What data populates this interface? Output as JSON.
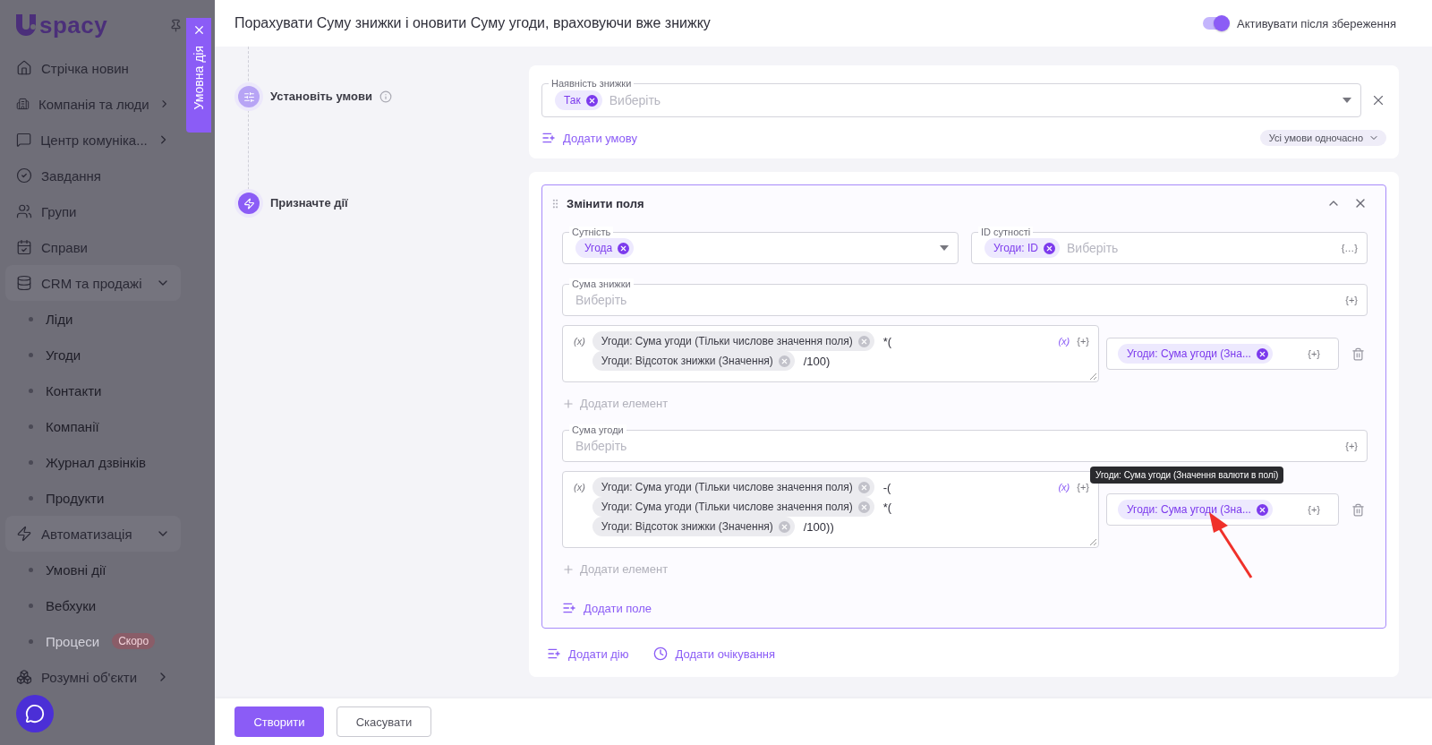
{
  "sidebar": {
    "logo_text": "spacy",
    "items": [
      {
        "label": "Стрічка новин"
      },
      {
        "label": "Компанія та люди",
        "expanded": false
      },
      {
        "label": "Центр комуніка...",
        "expanded": false
      },
      {
        "label": "Завдання"
      },
      {
        "label": "Групи"
      },
      {
        "label": "Справи"
      },
      {
        "label": "CRM та продажі",
        "expanded": true,
        "children": [
          {
            "label": "Ліди",
            "disabled": false
          },
          {
            "label": "Угоди",
            "disabled": false
          },
          {
            "label": "Контакти",
            "disabled": false
          },
          {
            "label": "Компанії",
            "disabled": false
          },
          {
            "label": "Журнал дзвінків",
            "disabled": false
          },
          {
            "label": "Продукти",
            "disabled": false
          }
        ]
      },
      {
        "label": "Автоматизація",
        "expanded": true,
        "children": [
          {
            "label": "Умовні дії",
            "disabled": false
          },
          {
            "label": "Вебхуки",
            "disabled": false
          },
          {
            "label": "Процеси",
            "disabled": true,
            "badge": "Скоро"
          }
        ]
      },
      {
        "label": "Розумні об'єкти",
        "expanded": false
      }
    ]
  },
  "side_tab": {
    "label": "Умовна дія"
  },
  "header": {
    "title": "Порахувати Суму знижки і оновити Суму угоди, враховуючи вже знижку",
    "activate_toggle": {
      "label": "Активувати після збереження",
      "on": true
    }
  },
  "steps": [
    {
      "label": "Установіть умови",
      "kind": "conditions"
    },
    {
      "label": "Призначте дії",
      "kind": "actions"
    }
  ],
  "conditions": {
    "field_label": "Наявність знижки",
    "chips": [
      {
        "label": "Так"
      }
    ],
    "placeholder": "Виберіть",
    "add_link": "Додати умову",
    "mode": "Усі умови одночасно"
  },
  "action": {
    "title": "Змінити поля",
    "expanded": true,
    "entity": {
      "label": "Сутність",
      "chips": [
        {
          "label": "Угода"
        }
      ]
    },
    "entity_id": {
      "label": "ID сутності",
      "chips": [
        {
          "label": "Угоди: ID"
        }
      ],
      "placeholder": "Виберіть",
      "icon_text": "{…}"
    },
    "fields": [
      {
        "label": "Сума знижки",
        "placeholder": "Виберіть",
        "insert_icon": "{+}",
        "formula": {
          "var_icon": "(x)",
          "var_button": "(x)",
          "insert_button": "{+}",
          "lines": [
            [
              {
                "kind": "chip",
                "text": "Угоди: Сума угоди (Тільки числове значення поля)"
              },
              {
                "kind": "op",
                "text": "*("
              }
            ],
            [
              {
                "kind": "chip",
                "text": "Угоди: Відсоток знижки (Значення)"
              },
              {
                "kind": "op",
                "text": "/100)"
              }
            ]
          ]
        },
        "value": {
          "chips": [
            {
              "label": "Угоди: Сума угоди (Зна..."
            }
          ],
          "insert_icon": "{+}"
        },
        "add_element": "Додати елемент"
      },
      {
        "label": "Сума угоди",
        "placeholder": "Виберіть",
        "insert_icon": "{+}",
        "formula": {
          "var_icon": "(x)",
          "var_button": "(x)",
          "insert_button": "{+}",
          "lines": [
            [
              {
                "kind": "chip",
                "text": "Угоди: Сума угоди (Тільки числове значення поля)"
              },
              {
                "kind": "op",
                "text": "-("
              }
            ],
            [
              {
                "kind": "chip",
                "text": "Угоди: Сума угоди (Тільки числове значення поля)"
              },
              {
                "kind": "op",
                "text": "*("
              }
            ],
            [
              {
                "kind": "chip",
                "text": "Угоди: Відсоток знижки (Значення)"
              },
              {
                "kind": "op",
                "text": "/100))"
              }
            ]
          ]
        },
        "value": {
          "chips": [
            {
              "label": "Угоди: Сума угоди (Зна..."
            }
          ],
          "insert_icon": "{+}",
          "tooltip": "Угоди: Сума угоди (Значення валюти в полі)",
          "pointer_arrow": true
        },
        "add_element": "Додати елемент"
      }
    ],
    "add_field": "Додати поле"
  },
  "add_action": "Додати дію",
  "add_wait": "Додати очікування",
  "footer": {
    "buttons": [
      {
        "label": "Створити",
        "kind": "primary"
      },
      {
        "label": "Скасувати",
        "kind": "secondary"
      }
    ]
  }
}
